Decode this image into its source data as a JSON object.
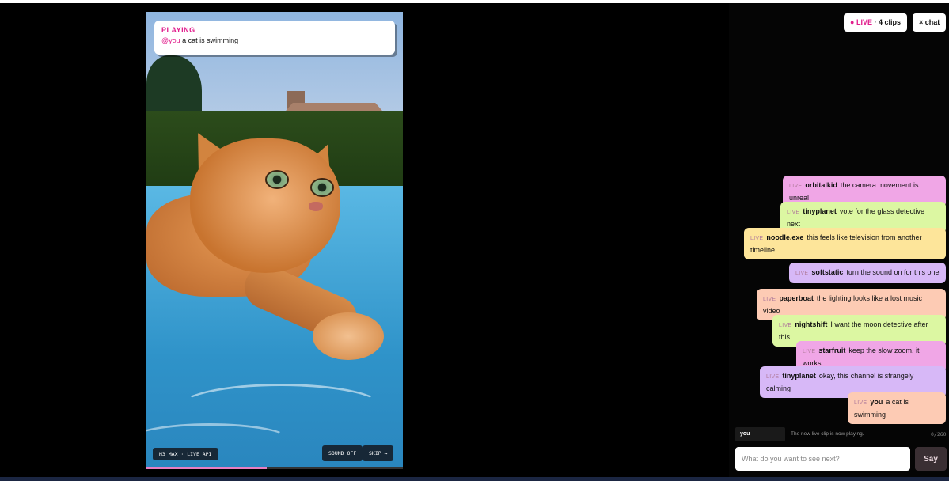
{
  "video": {
    "playing_label": "PLAYING",
    "prompt_user": "@you",
    "prompt_text": "a cat is swimming",
    "model_tag": "H3 MAX · LIVE API",
    "sound_button": "SOUND OFF",
    "skip_button": "SKIP →",
    "progress": 0.47
  },
  "header": {
    "live_dot": "●",
    "live_label": "LIVE",
    "clips_label": "· 4 clips",
    "chat_toggle": "× chat"
  },
  "chat": {
    "messages": [
      {
        "tag": "LIVE",
        "user": "orbitalkid",
        "text": "the camera movement is unreal",
        "color": "#f0a6e6"
      },
      {
        "tag": "LIVE",
        "user": "tinyplanet",
        "text": "vote for the glass detective next",
        "color": "#dcf7a2"
      },
      {
        "tag": "LIVE",
        "user": "noodle.exe",
        "text": "this feels like television from another timeline",
        "color": "#fde59a"
      },
      {
        "tag": "LIVE",
        "user": "softstatic",
        "text": "turn the sound on for this one",
        "color": "#d7b8f7"
      },
      {
        "tag": "LIVE",
        "user": "paperboat",
        "text": "the lighting looks like a lost music video",
        "color": "#fdcbb4"
      },
      {
        "tag": "LIVE",
        "user": "nightshift",
        "text": "I want the moon detective after this",
        "color": "#dcf7a2"
      },
      {
        "tag": "LIVE",
        "user": "starfruit",
        "text": "keep the slow zoom, it works",
        "color": "#f0a6e6"
      },
      {
        "tag": "LIVE",
        "user": "tinyplanet",
        "text": "okay, this channel is strangely calming",
        "color": "#d7b8f7"
      },
      {
        "tag": "LIVE",
        "user": "you",
        "text": "a cat is swimming",
        "color": "#fdcbb4"
      }
    ],
    "you_label": "you",
    "status": "The new live clip is now playing.",
    "char_count": "0/260",
    "input_placeholder": "What do you want to see next?",
    "send_label": "Say"
  }
}
